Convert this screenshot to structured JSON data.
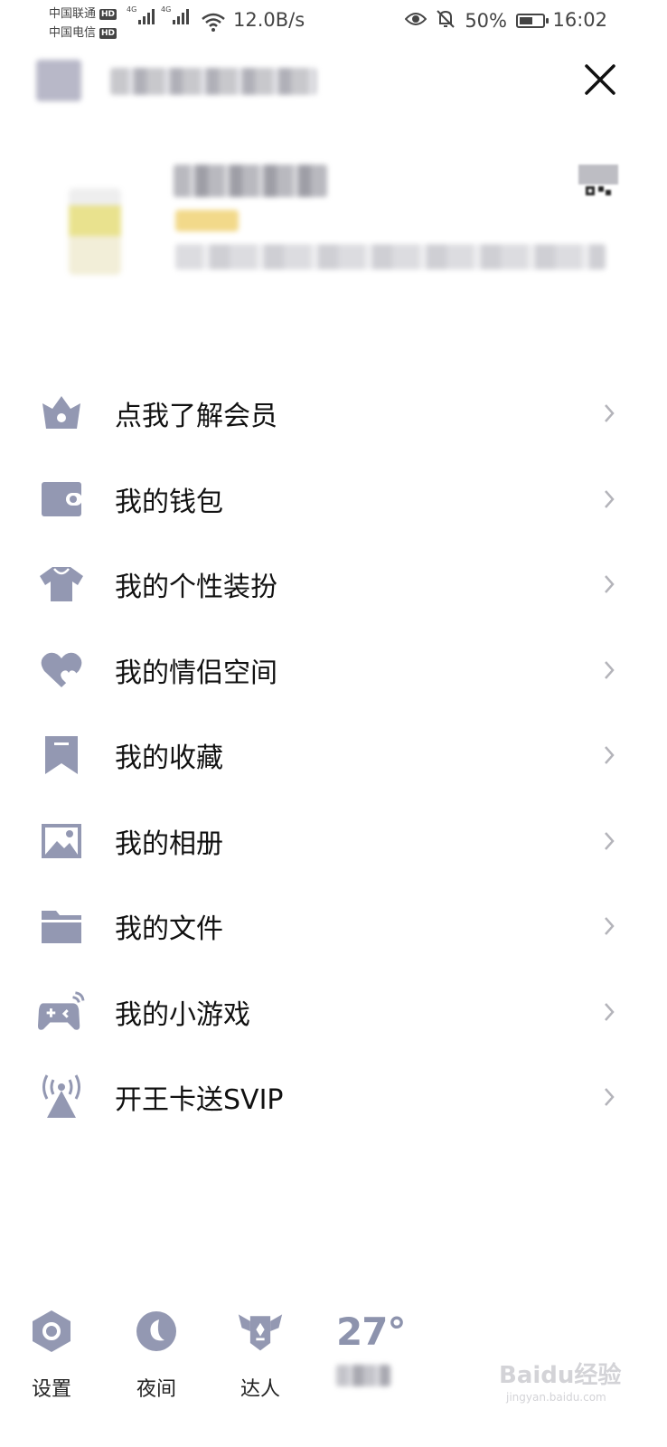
{
  "status_bar": {
    "carrier_1": "中国联通",
    "carrier_2": "中国电信",
    "hd": "HD",
    "network": "4G",
    "speed": "12.0B/s",
    "battery": "50%",
    "time": "16:02"
  },
  "menu": {
    "items": [
      {
        "label": "点我了解会员",
        "icon": "crown-icon"
      },
      {
        "label": "我的钱包",
        "icon": "wallet-icon"
      },
      {
        "label": "我的个性装扮",
        "icon": "tshirt-icon"
      },
      {
        "label": "我的情侣空间",
        "icon": "heart-icon"
      },
      {
        "label": "我的收藏",
        "icon": "bookmark-icon"
      },
      {
        "label": "我的相册",
        "icon": "picture-icon"
      },
      {
        "label": "我的文件",
        "icon": "folder-icon"
      },
      {
        "label": "我的小游戏",
        "icon": "gamepad-icon"
      },
      {
        "label": "开王卡送SVIP",
        "icon": "signal-tower-icon"
      }
    ]
  },
  "bottom_bar": {
    "settings_label": "设置",
    "night_label": "夜间",
    "expert_label": "达人",
    "temperature": "27°"
  },
  "watermark": {
    "brand": "Baidu经验",
    "url": "jingyan.baidu.com"
  },
  "colors": {
    "icon": "#9398b2",
    "chevron": "#b4b4ba",
    "text": "#111111"
  }
}
